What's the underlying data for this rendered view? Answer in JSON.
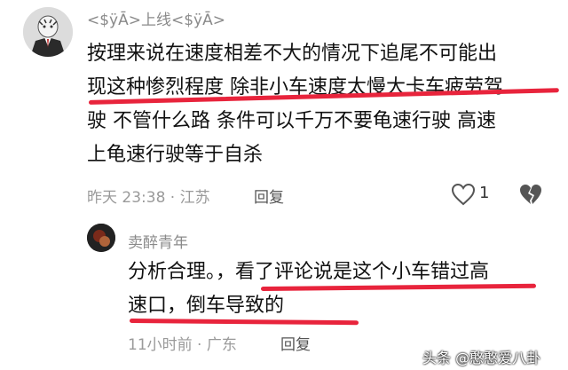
{
  "comment1": {
    "username": "<$ÿĀ>上线<$ÿĀ>",
    "lines": [
      "按理来说在速度相差不大的情况下追尾不可能出",
      "现这种惨烈程度  除非小车速度太慢大卡车疲劳驾",
      "驶  不管什么路  条件可以千万不要龟速行驶  高速",
      "上龟速行驶等于自杀"
    ],
    "meta": "昨天 23:38 · 江苏",
    "reply_label": "回复",
    "like_count": "1",
    "like_icon": "heart-outline-icon",
    "dislike_icon": "broken-heart-icon"
  },
  "comment2": {
    "username": "卖醉青年",
    "lines": [
      "分析合理。，看了评论说是这个小车错过高",
      "速口，倒车导致的"
    ],
    "meta": "11小时前 · 广东",
    "reply_label": "回复"
  },
  "watermark": "头条 @憨憨爱八卦",
  "colors": {
    "highlight_underline": "#e8243c",
    "meta_gray": "#9a9a9a"
  }
}
